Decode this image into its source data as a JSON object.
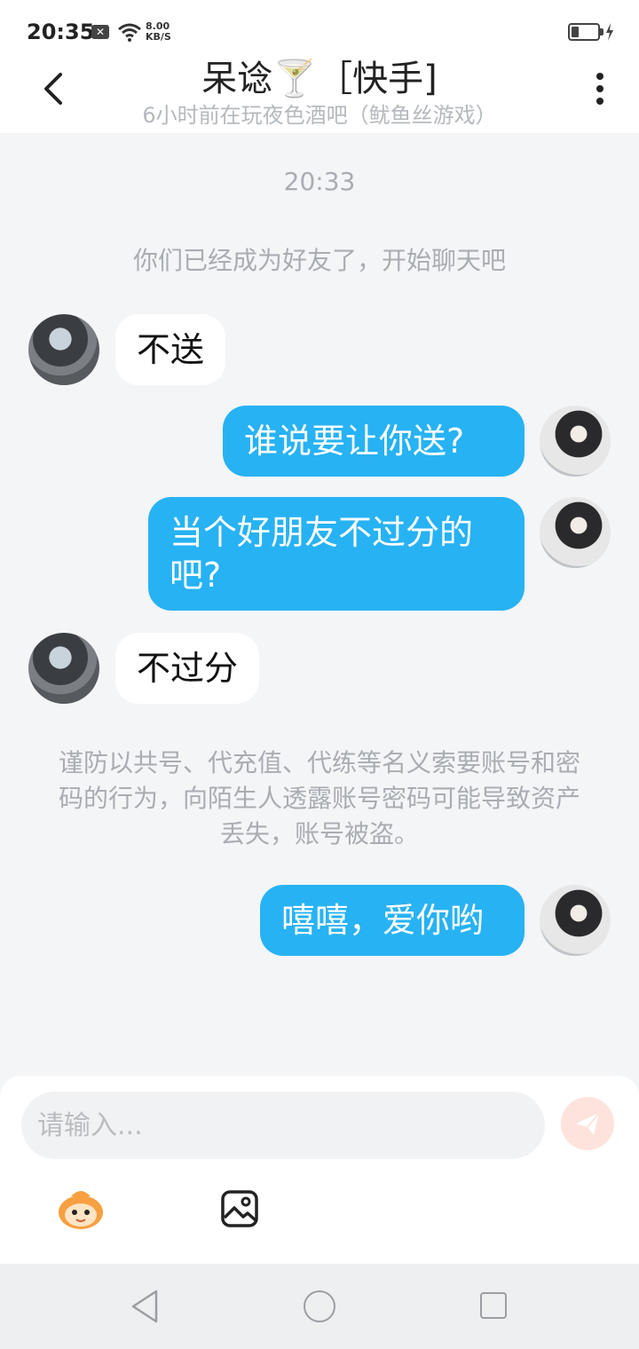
{
  "status_bar": {
    "time": "20:35",
    "net_speed_value": "8.00",
    "net_speed_unit": "KB/S"
  },
  "header": {
    "title": "呆谂🍸［快手]",
    "subtitle": "6小时前在玩夜色酒吧（鱿鱼丝游戏）"
  },
  "chat": {
    "time_separator": "20:33",
    "system_notice": "你们已经成为好友了，开始聊天吧",
    "warning": "谨防以共号、代充值、代练等名义索要账号和密码的行为，向陌生人透露账号密码可能导致资产丢失，账号被盗。",
    "messages": [
      {
        "side": "left",
        "text": "不送"
      },
      {
        "side": "right",
        "text": "谁说要让你送?"
      },
      {
        "side": "right",
        "text": "当个好朋友不过分的吧?"
      },
      {
        "side": "left",
        "text": "不过分"
      },
      {
        "side": "right",
        "text": "嘻嘻，爱你哟"
      }
    ]
  },
  "composer": {
    "placeholder": "请输入..."
  },
  "colors": {
    "outgoing_bubble": "#27b2f3",
    "incoming_bubble": "#ffffff",
    "background": "#f3f5f7",
    "send_button": "#fde3dc"
  }
}
